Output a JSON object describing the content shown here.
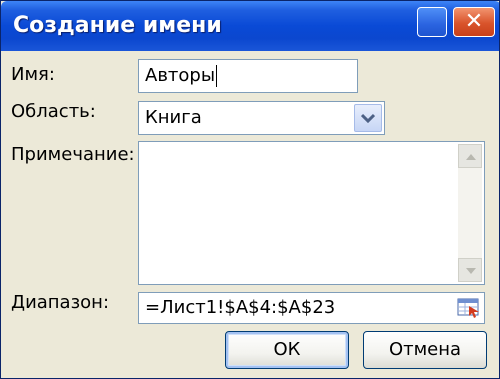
{
  "window": {
    "title": "Создание имени",
    "close_glyph": "✕"
  },
  "fields": {
    "name_label": "Имя:",
    "name_value": "Авторы",
    "scope_label": "Область:",
    "scope_value": "Книга",
    "comment_label": "Примечание:",
    "comment_value": "",
    "range_label": "Диапазон:",
    "range_value": "=Лист1!$A$4:$A$23"
  },
  "buttons": {
    "ok": "ОК",
    "cancel": "Отмена"
  },
  "icons": {
    "help": "help-icon",
    "close": "close-icon",
    "dropdown": "chevron-down-icon",
    "scroll_up": "arrow-up-icon",
    "scroll_down": "arrow-down-icon",
    "range_select": "range-select-icon"
  }
}
